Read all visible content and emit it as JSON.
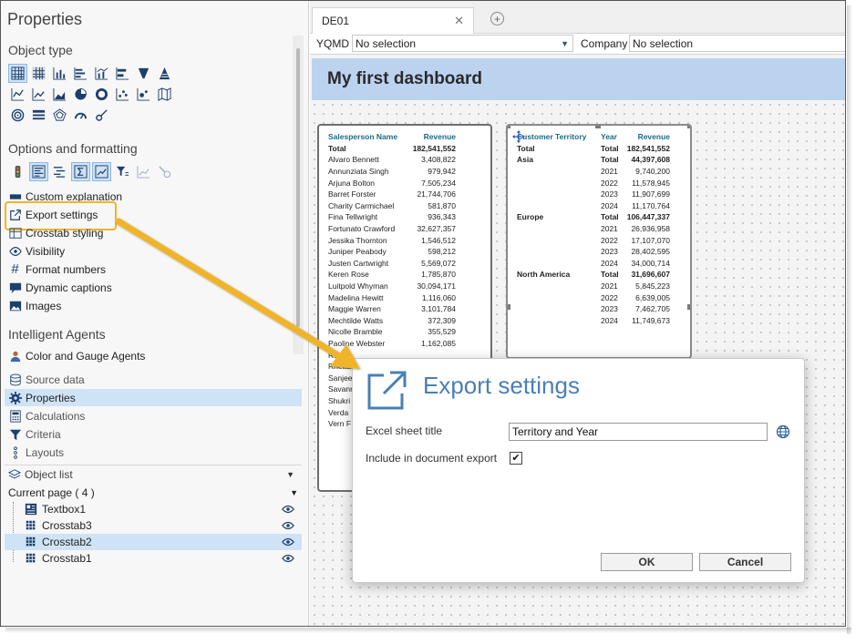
{
  "panel": {
    "title": "Properties",
    "object_type_heading": "Object type",
    "options_heading": "Options and formatting",
    "agents_heading": "Intelligent Agents",
    "items": [
      {
        "label": "Custom explanation"
      },
      {
        "label": "Export settings"
      },
      {
        "label": "Crosstab styling"
      },
      {
        "label": "Visibility"
      },
      {
        "label": "Format numbers"
      },
      {
        "label": "Dynamic captions"
      },
      {
        "label": "Images"
      }
    ],
    "agent_items": [
      {
        "label": "Color and Gauge Agents"
      }
    ],
    "nav": [
      {
        "label": "Source data"
      },
      {
        "label": "Properties"
      },
      {
        "label": "Calculations"
      },
      {
        "label": "Criteria"
      },
      {
        "label": "Layouts"
      }
    ],
    "object_list_label": "Object list",
    "current_page_label": "Current page ( 4 )",
    "objects": [
      "Textbox1",
      "Crosstab3",
      "Crosstab2",
      "Crosstab1"
    ]
  },
  "tabs": [
    {
      "label": "DE01"
    }
  ],
  "filters": [
    {
      "label": "YQMD",
      "value": "No selection"
    },
    {
      "label": "Company",
      "value": "No selection"
    }
  ],
  "dashboard": {
    "title": "My first dashboard",
    "crosstab1": {
      "headers": [
        "Salesperson Name",
        "Revenue"
      ],
      "rows": [
        [
          "Total",
          "182,541,552"
        ],
        [
          "Alvaro Bennett",
          "3,408,822"
        ],
        [
          "Annunziata Singh",
          "979,942"
        ],
        [
          "Arjuna Bolton",
          "7,505,234"
        ],
        [
          "Barret Forster",
          "21,744,706"
        ],
        [
          "Charity Carmichael",
          "581,870"
        ],
        [
          "Fina Tellwright",
          "936,343"
        ],
        [
          "Fortunato Crawford",
          "32,627,357"
        ],
        [
          "Jessika Thornton",
          "1,546,512"
        ],
        [
          "Juniper Peabody",
          "598,212"
        ],
        [
          "Justen Cartwright",
          "5,569,072"
        ],
        [
          "Keren Rose",
          "1,785,870"
        ],
        [
          "Luitpold Whyman",
          "30,094,171"
        ],
        [
          "Madelina Hewitt",
          "1,116,060"
        ],
        [
          "Maggie Warren",
          "3,101,784"
        ],
        [
          "Mechtilde Watts",
          "372,309"
        ],
        [
          "Nicolle Bramble",
          "355,529"
        ],
        [
          "Paoline Webster",
          "1,162,085"
        ],
        [
          "Regel",
          ""
        ],
        [
          "Rhetta",
          ""
        ],
        [
          "Sanjee",
          ""
        ],
        [
          "Savann",
          ""
        ],
        [
          "Shukri",
          ""
        ],
        [
          "Verda",
          ""
        ],
        [
          "Vern F",
          ""
        ]
      ]
    },
    "crosstab2": {
      "headers": [
        "Customer Territory",
        "Year",
        "Revenue"
      ],
      "rows": [
        [
          "Total",
          "Total",
          "182,541,552"
        ],
        [
          "Asia",
          "Total",
          "44,397,608"
        ],
        [
          "",
          "2021",
          "9,740,200"
        ],
        [
          "",
          "2022",
          "11,578,945"
        ],
        [
          "",
          "2023",
          "11,907,699"
        ],
        [
          "",
          "2024",
          "11,170,764"
        ],
        [
          "Europe",
          "Total",
          "106,447,337"
        ],
        [
          "",
          "2021",
          "26,936,958"
        ],
        [
          "",
          "2022",
          "17,107,070"
        ],
        [
          "",
          "2023",
          "28,402,595"
        ],
        [
          "",
          "2024",
          "34,000,714"
        ],
        [
          "North America",
          "Total",
          "31,696,607"
        ],
        [
          "",
          "2021",
          "5,845,223"
        ],
        [
          "",
          "2022",
          "6,639,005"
        ],
        [
          "",
          "2023",
          "7,462,705"
        ],
        [
          "",
          "2024",
          "11,749,673"
        ]
      ]
    }
  },
  "dialog": {
    "title": "Export settings",
    "sheet_label": "Excel sheet title",
    "sheet_value": "Territory and Year",
    "include_label": "Include in document export",
    "include_checked": true,
    "ok": "OK",
    "cancel": "Cancel"
  },
  "colors": {
    "accent": "#4a7fb5",
    "callout": "#f0b429",
    "header_band": "#bcd3f0",
    "selection": "#cfe3f7",
    "crosstab_header": "#1a6a8a"
  }
}
